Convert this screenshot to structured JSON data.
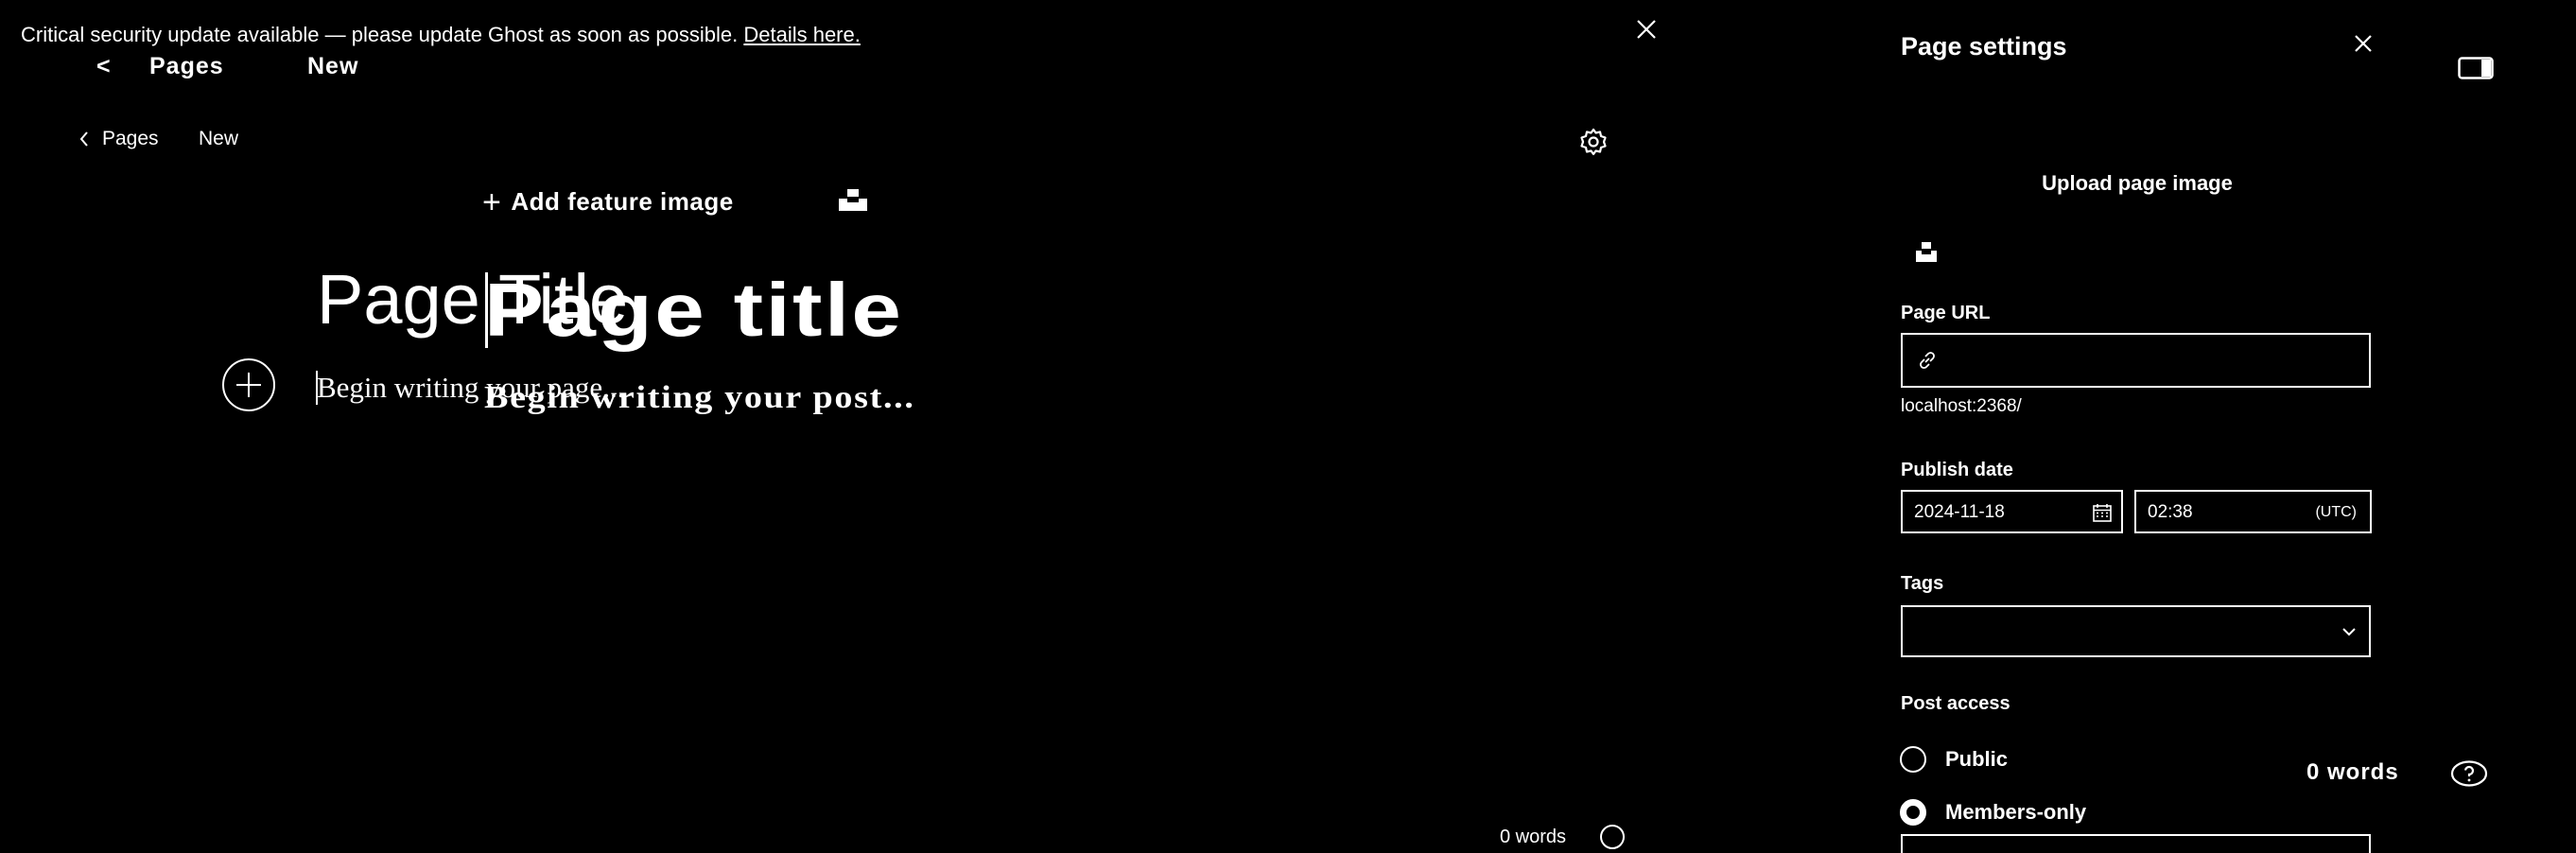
{
  "banner": {
    "message": "Critical security update available — please update Ghost as soon as possible.",
    "link_label": "Details here."
  },
  "overlay_header": {
    "back_glyph": "<",
    "pages_label": "Pages",
    "new_label": "New"
  },
  "editor": {
    "breadcrumb": {
      "pages_label": "Pages",
      "new_label": "New"
    },
    "feature_image_label": "Add feature image",
    "title_placeholder": "Page Title",
    "title_overlay": "Page title",
    "body_placeholder": "Begin writing your page...",
    "body_overlay": "Begin writing your post...",
    "word_count": "0 words"
  },
  "settings_panel": {
    "title": "Page settings",
    "upload_label": "Upload page image",
    "page_url": {
      "label": "Page URL",
      "value": "",
      "hint": "localhost:2368/"
    },
    "publish_date": {
      "label": "Publish date",
      "date": "2024-11-18",
      "time": "02:38",
      "timezone": "(UTC)"
    },
    "tags": {
      "label": "Tags",
      "value": ""
    },
    "post_access": {
      "label": "Post access",
      "options": [
        {
          "label": "Public",
          "selected": false
        },
        {
          "label": "Members-only",
          "selected": true
        }
      ]
    },
    "word_count": "0 words"
  },
  "icons": {
    "banner_close": "close-icon",
    "editor_settings": "gear-icon",
    "unsplash": "unsplash-icon",
    "add_card": "plus-circle-icon",
    "panel_close": "close-icon",
    "panel_toggle": "sidebar-toggle-icon",
    "link": "link-icon",
    "calendar": "calendar-icon",
    "dropdown": "chevron-down-icon",
    "help": "help-icon"
  },
  "colors": {
    "background": "#000000",
    "foreground": "#ffffff"
  }
}
